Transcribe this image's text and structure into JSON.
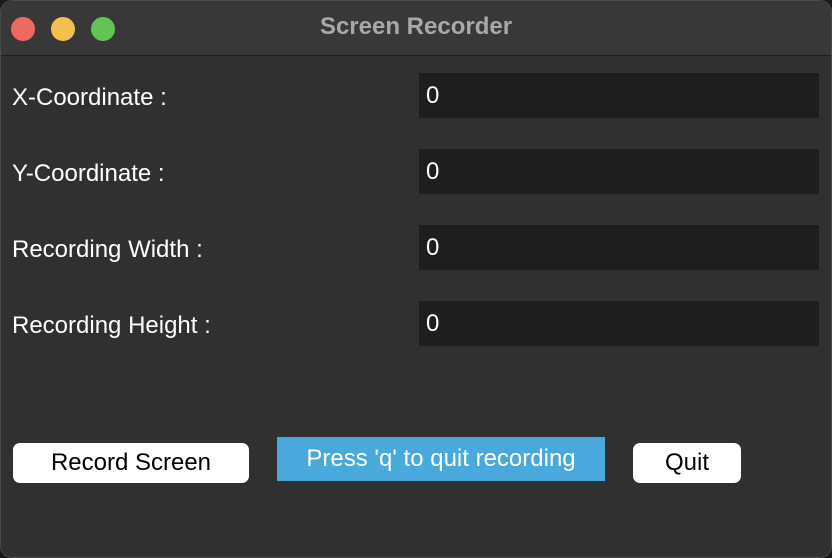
{
  "window": {
    "title": "Screen Recorder"
  },
  "form": {
    "rows": [
      {
        "label": "X-Coordinate :",
        "value": "0"
      },
      {
        "label": "Y-Coordinate :",
        "value": "0"
      },
      {
        "label": "Recording Width :",
        "value": "0"
      },
      {
        "label": "Recording Height :",
        "value": "0"
      }
    ]
  },
  "actions": {
    "record_label": "Record Screen",
    "hint_text": "Press 'q' to quit recording",
    "quit_label": "Quit"
  },
  "colors": {
    "window_bg": "#303030",
    "field_bg": "#1e1e1e",
    "hint_bg": "#4aa9dc",
    "close": "#ed6a5e",
    "minimize": "#f5bf4f",
    "maximize": "#61c554"
  }
}
